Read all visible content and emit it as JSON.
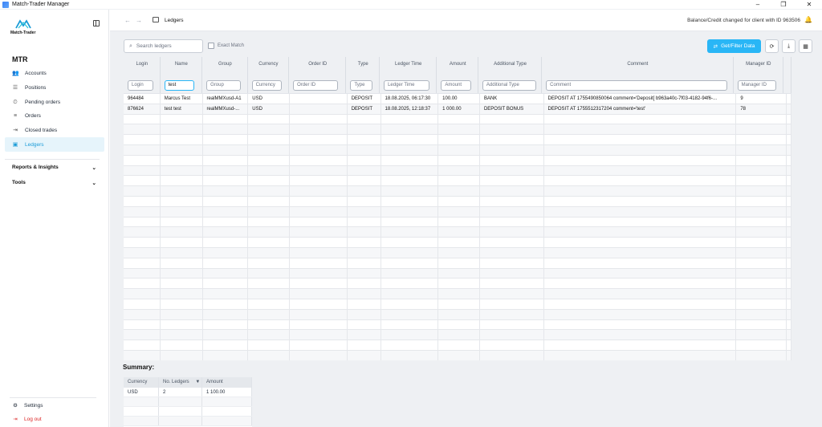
{
  "window": {
    "title": "Match-Trader Manager",
    "controls": [
      "–",
      "❐",
      "✕"
    ]
  },
  "sidebar": {
    "brand": "Match-Trader",
    "section_title": "MTR",
    "items": [
      {
        "label": "Accounts",
        "icon": "accounts-icon",
        "glyph": "👥"
      },
      {
        "label": "Positions",
        "icon": "positions-icon",
        "glyph": "☰"
      },
      {
        "label": "Pending orders",
        "icon": "pending-orders-icon",
        "glyph": "⏲"
      },
      {
        "label": "Orders",
        "icon": "orders-icon",
        "glyph": "≡"
      },
      {
        "label": "Closed trades",
        "icon": "closed-trades-icon",
        "glyph": "⇥"
      },
      {
        "label": "Ledgers",
        "icon": "ledgers-icon",
        "glyph": "▣",
        "active": true
      }
    ],
    "groups": [
      {
        "label": "Reports & Insights"
      },
      {
        "label": "Tools"
      }
    ],
    "settings_label": "Settings",
    "logout_label": "Log out"
  },
  "topbar": {
    "back": "←",
    "forward": "→",
    "breadcrumb": "Ledgers",
    "notice": "Balance/Credit changed for client with ID 963506",
    "bell": "🔔"
  },
  "toolbar": {
    "search_placeholder": "Search ledgers",
    "exact_match_label": "Exact Match",
    "get_button_label": "Get/Filter Data",
    "refresh_icon": "⟳",
    "download_icon": "⤓",
    "columns_icon": "▦"
  },
  "table": {
    "columns": [
      {
        "label": "Login",
        "placeholder": "Login",
        "value": ""
      },
      {
        "label": "Name",
        "placeholder": "Name",
        "value": "test"
      },
      {
        "label": "Group",
        "placeholder": "Group",
        "value": ""
      },
      {
        "label": "Currency",
        "placeholder": "Currency",
        "value": ""
      },
      {
        "label": "Order ID",
        "placeholder": "Order ID",
        "value": ""
      },
      {
        "label": "Type",
        "placeholder": "Type",
        "value": ""
      },
      {
        "label": "Ledger Time",
        "placeholder": "Ledger Time",
        "value": ""
      },
      {
        "label": "Amount",
        "placeholder": "Amount",
        "value": ""
      },
      {
        "label": "Additional Type",
        "placeholder": "Additional Type",
        "value": ""
      },
      {
        "label": "Comment",
        "placeholder": "Comment",
        "value": ""
      },
      {
        "label": "Manager ID",
        "placeholder": "Manager ID",
        "value": ""
      }
    ],
    "rows": [
      [
        "964484",
        "Marcus Test",
        "realMMXusd-A1",
        "USD",
        "",
        "DEPOSIT",
        "18.08.2025, 06:17:30",
        "100.00",
        "BANK",
        "DEPOSIT AT 1755490850064 comment='Deposit[ b963a40c-7f03-4182-94f6-...",
        "9"
      ],
      [
        "876624",
        "test test",
        "realMMXusd-...",
        "USD",
        "",
        "DEPOSIT",
        "18.08.2025, 12:18:37",
        "1 000.00",
        "DEPOSIT BONUS",
        "DEPOSIT AT 1755512317204 comment='test'",
        "78"
      ]
    ]
  },
  "summary": {
    "title": "Summary:",
    "columns": [
      "Currency",
      "No. Ledgers",
      "Amount"
    ],
    "sort_indicator": "▼",
    "rows": [
      [
        "USD",
        "2",
        "1 100.00"
      ]
    ]
  }
}
